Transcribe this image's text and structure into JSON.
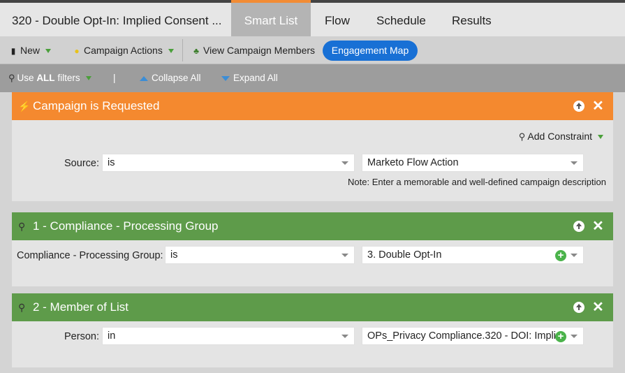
{
  "tabs": {
    "program": "320 - Double Opt-In: Implied Consent ...",
    "active": "Smart List",
    "flow": "Flow",
    "schedule": "Schedule",
    "results": "Results"
  },
  "toolbar": {
    "new": "New",
    "campaign_actions": "Campaign Actions",
    "view_members": "View Campaign Members",
    "engagement_map": "Engagement Map"
  },
  "filterbar": {
    "use_prefix": "Use",
    "use_all": "ALL",
    "use_suffix": "filters",
    "divider": "|",
    "collapse": "Collapse All",
    "expand": "Expand All"
  },
  "trigger": {
    "title": "Campaign is Requested",
    "add_constraint": "Add Constraint",
    "source_label": "Source:",
    "operator": "is",
    "value": "Marketo Flow Action",
    "note": "Note: Enter a memorable and well-defined campaign description"
  },
  "filter1": {
    "title": "1 - Compliance - Processing Group",
    "label": "Compliance - Processing Group:",
    "operator": "is",
    "value": "3. Double Opt-In"
  },
  "filter2": {
    "title": "2 - Member of List",
    "label": "Person:",
    "operator": "in",
    "value": "OPs_Privacy Compliance.320 - DOI: Impli"
  },
  "colors": {
    "trigger_header": "#f4892f",
    "filter_header": "#5e9b4a",
    "engagement_button": "#1870d5"
  }
}
